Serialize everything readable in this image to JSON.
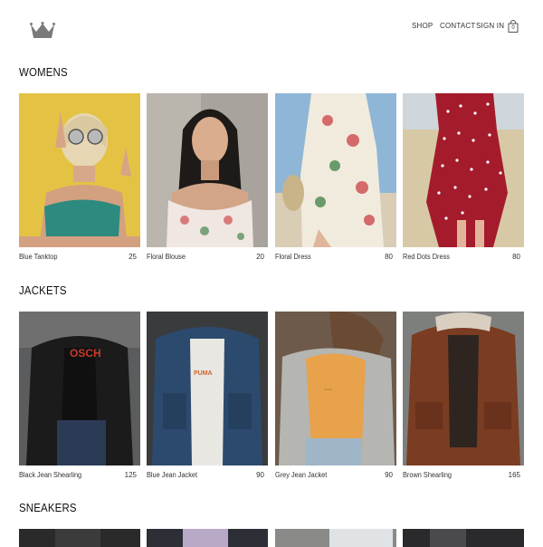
{
  "header": {
    "logo_icon": "crown-icon",
    "nav": {
      "shop": "SHOP",
      "contact": "CONTACT",
      "sign_in": "SIGN IN"
    },
    "bag_icon": "shopping-bag-icon",
    "bag_count": "0"
  },
  "sections": {
    "womens": {
      "title": "WOMENS",
      "items": [
        {
          "name": "Blue Tanktop",
          "price": "25"
        },
        {
          "name": "Floral Blouse",
          "price": "20"
        },
        {
          "name": "Floral Dress",
          "price": "80"
        },
        {
          "name": "Red Dots Dress",
          "price": "80"
        }
      ]
    },
    "jackets": {
      "title": "JACKETS",
      "items": [
        {
          "name": "Black Jean Shearling",
          "price": "125"
        },
        {
          "name": "Blue Jean Jacket",
          "price": "90"
        },
        {
          "name": "Grey Jean Jacket",
          "price": "90"
        },
        {
          "name": "Brown Shearling",
          "price": "165"
        }
      ]
    },
    "sneakers": {
      "title": "SNEAKERS"
    }
  },
  "colors": {
    "text": "#222222",
    "background": "#ffffff"
  }
}
